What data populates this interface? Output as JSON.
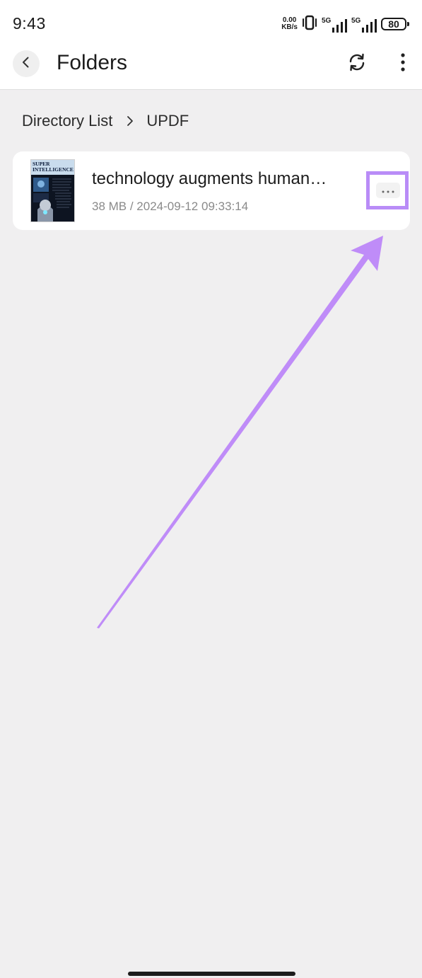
{
  "status_bar": {
    "time": "9:43",
    "net_speed_value": "0.00",
    "net_speed_unit": "KB/s",
    "sim1_label": "5G",
    "sim2_label": "5G",
    "battery_level": "80"
  },
  "app_bar": {
    "title": "Folders"
  },
  "breadcrumb": {
    "root": "Directory List",
    "current": "UPDF"
  },
  "files": [
    {
      "name": "technology augments human…",
      "meta": "38 MB / 2024-09-12 09:33:14",
      "thumbnail_title_line1": "SUPER",
      "thumbnail_title_line2": "INTELLIGENCE"
    }
  ],
  "colors": {
    "annotation_accent": "#b98cf7",
    "background": "#f0eff0",
    "card": "#ffffff"
  },
  "icons": {
    "back": "chevron-left-icon",
    "sync": "sync-icon",
    "more": "more-vertical-icon",
    "breadcrumb_separator": "chevron-right-icon",
    "file_more": "more-horizontal-icon"
  }
}
